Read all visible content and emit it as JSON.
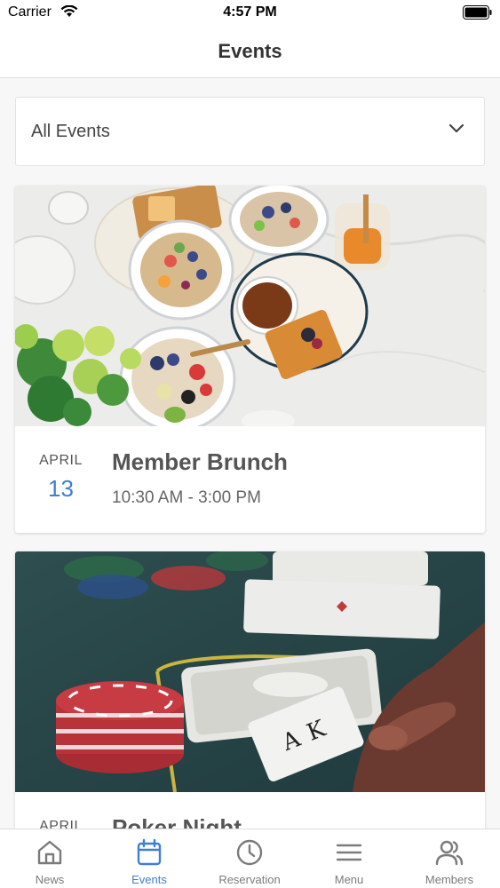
{
  "status_bar": {
    "carrier": "Carrier",
    "time": "4:57 PM"
  },
  "nav": {
    "title": "Events"
  },
  "filter": {
    "selected": "All Events"
  },
  "events": [
    {
      "month": "APRIL",
      "day": "13",
      "title": "Member Brunch",
      "time": "10:30 AM - 3:00 PM"
    },
    {
      "month": "APRIL",
      "title": "Poker Night"
    }
  ],
  "tabs": [
    {
      "label": "News",
      "icon": "home-icon",
      "active": false
    },
    {
      "label": "Events",
      "icon": "calendar-icon",
      "active": true
    },
    {
      "label": "Reservation",
      "icon": "clock-icon",
      "active": false
    },
    {
      "label": "Menu",
      "icon": "menu-icon",
      "active": false
    },
    {
      "label": "Members",
      "icon": "users-icon",
      "active": false
    }
  ],
  "colors": {
    "accent": "#3f7fd0",
    "tab_inactive": "#7b7b7b"
  }
}
